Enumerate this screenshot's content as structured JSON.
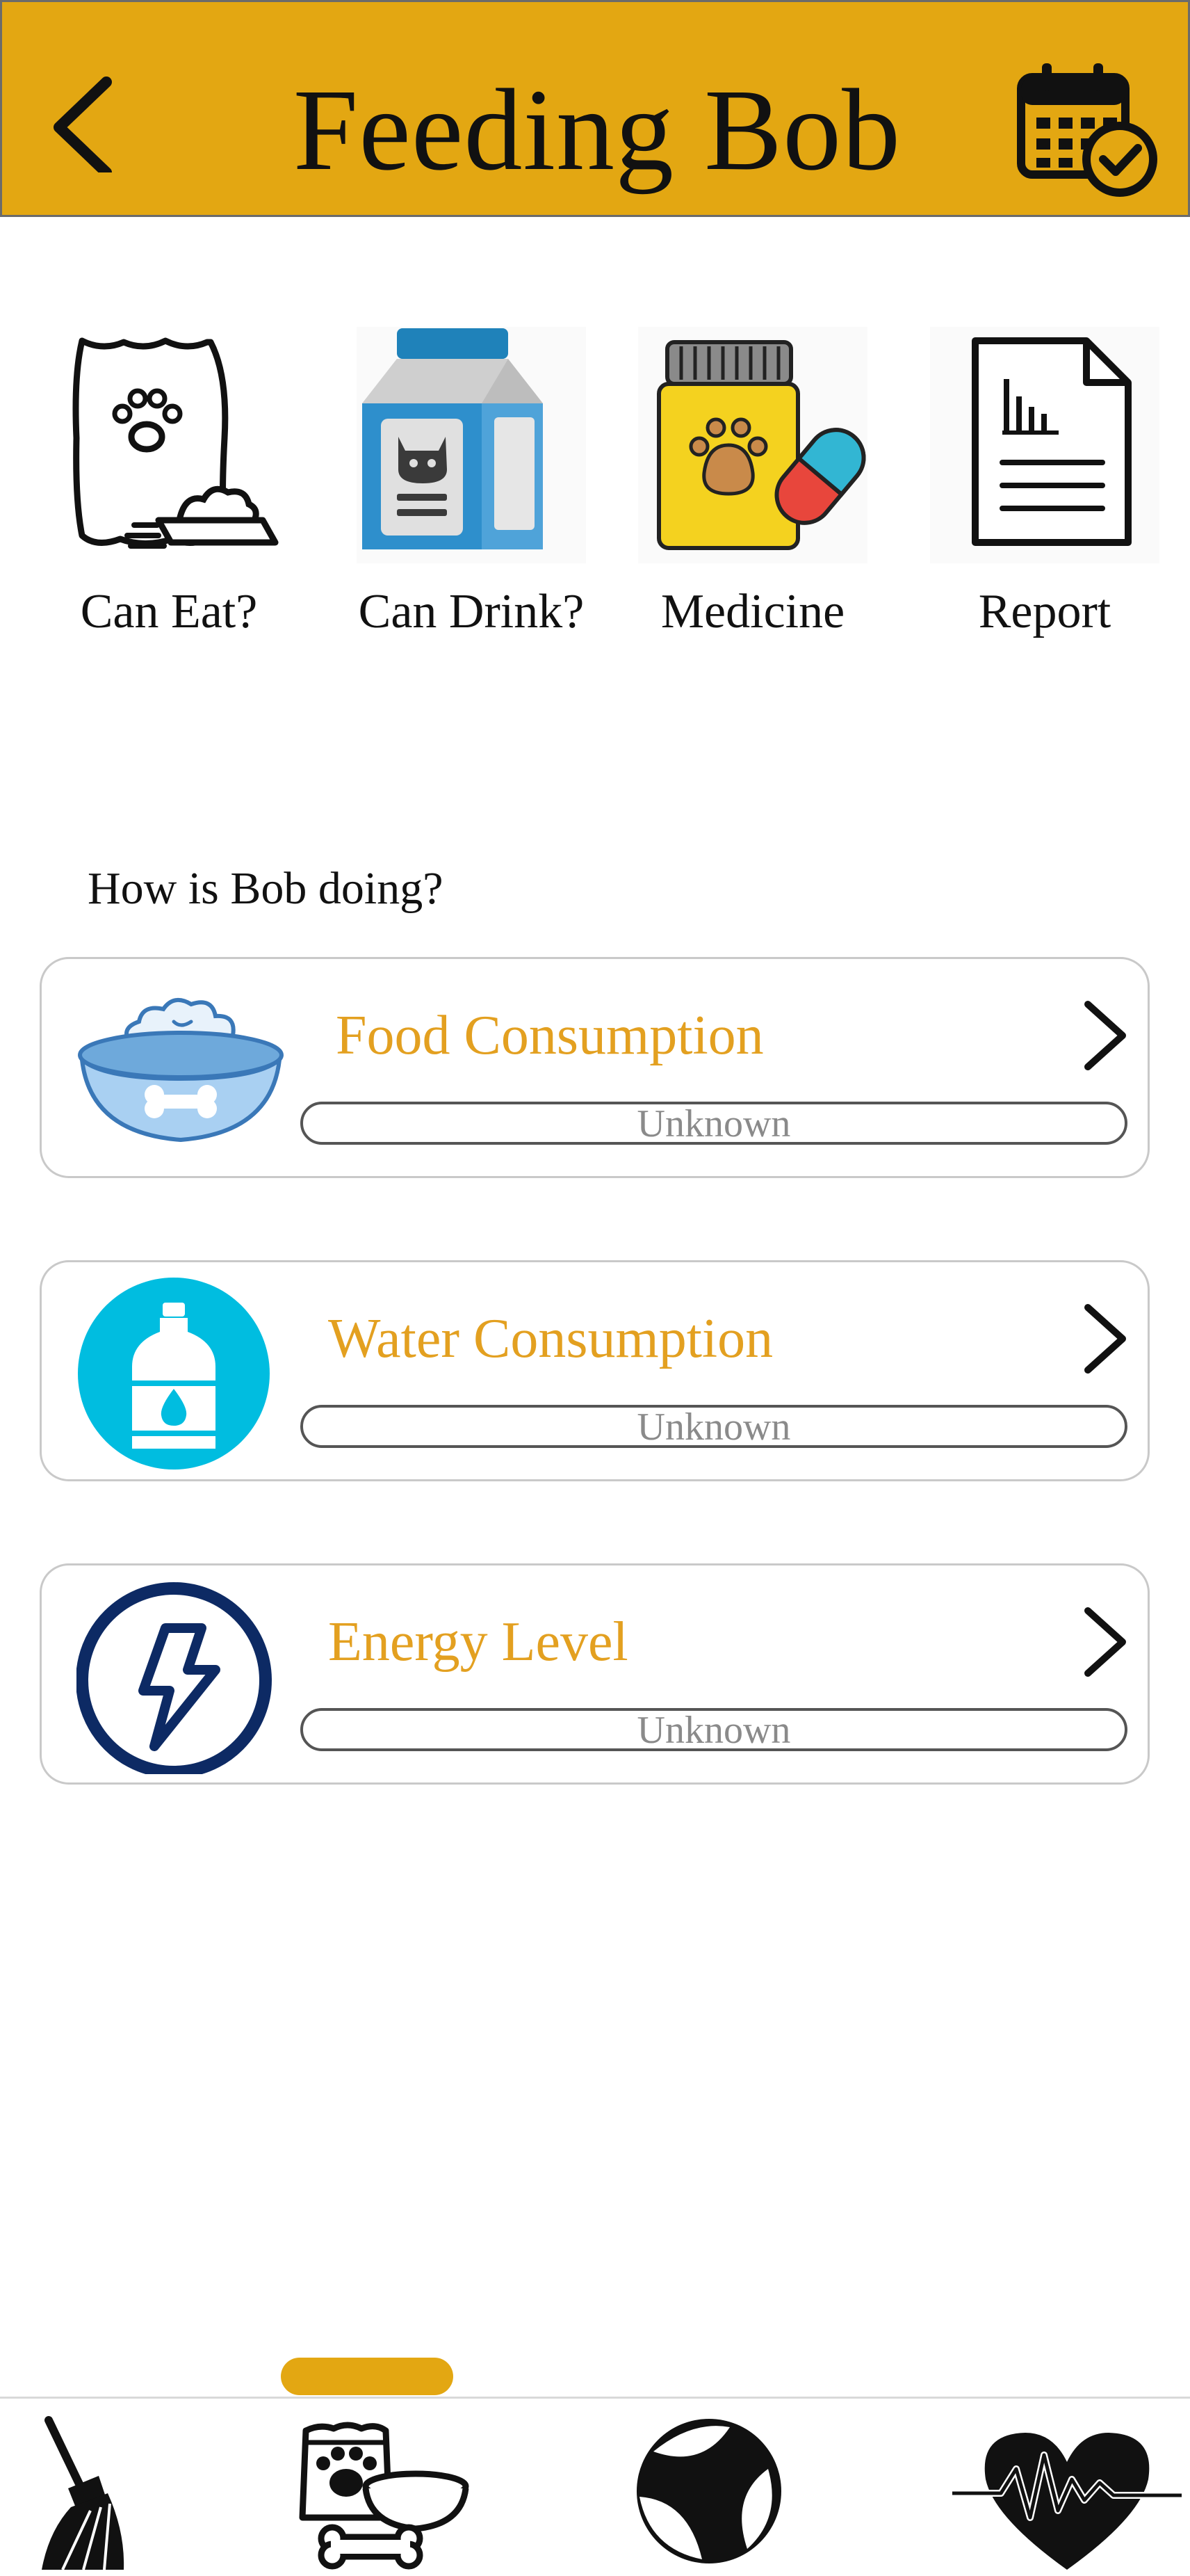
{
  "header": {
    "title": "Feeding Bob",
    "back_icon": "chevron-left-icon",
    "calendar_icon": "calendar-check-icon",
    "background_color": "#e3a712"
  },
  "quick_actions": [
    {
      "label": "Can Eat?",
      "icon": "food-bag-icon"
    },
    {
      "label": "Can Drink?",
      "icon": "milk-carton-icon"
    },
    {
      "label": "Medicine",
      "icon": "medicine-bottle-icon"
    },
    {
      "label": "Report",
      "icon": "report-document-icon"
    }
  ],
  "status_section": {
    "title": "How is Bob doing?",
    "cards": [
      {
        "title": "Food Consumption",
        "status": "Unknown",
        "level": 0,
        "icon": "food-bowl-icon"
      },
      {
        "title": "Water Consumption",
        "status": "Unknown",
        "level": 0,
        "icon": "water-bottle-icon"
      },
      {
        "title": "Energy Level",
        "status": "Unknown",
        "level": 0,
        "icon": "lightning-icon"
      }
    ],
    "title_color": "#e3a020"
  },
  "bottom_nav": {
    "items": [
      {
        "name": "cleaning",
        "icon": "broom-icon"
      },
      {
        "name": "feeding",
        "icon": "pet-food-icon",
        "active": true
      },
      {
        "name": "play",
        "icon": "beach-ball-icon"
      },
      {
        "name": "health",
        "icon": "heartbeat-icon"
      }
    ],
    "active_color": "#e3a712"
  }
}
